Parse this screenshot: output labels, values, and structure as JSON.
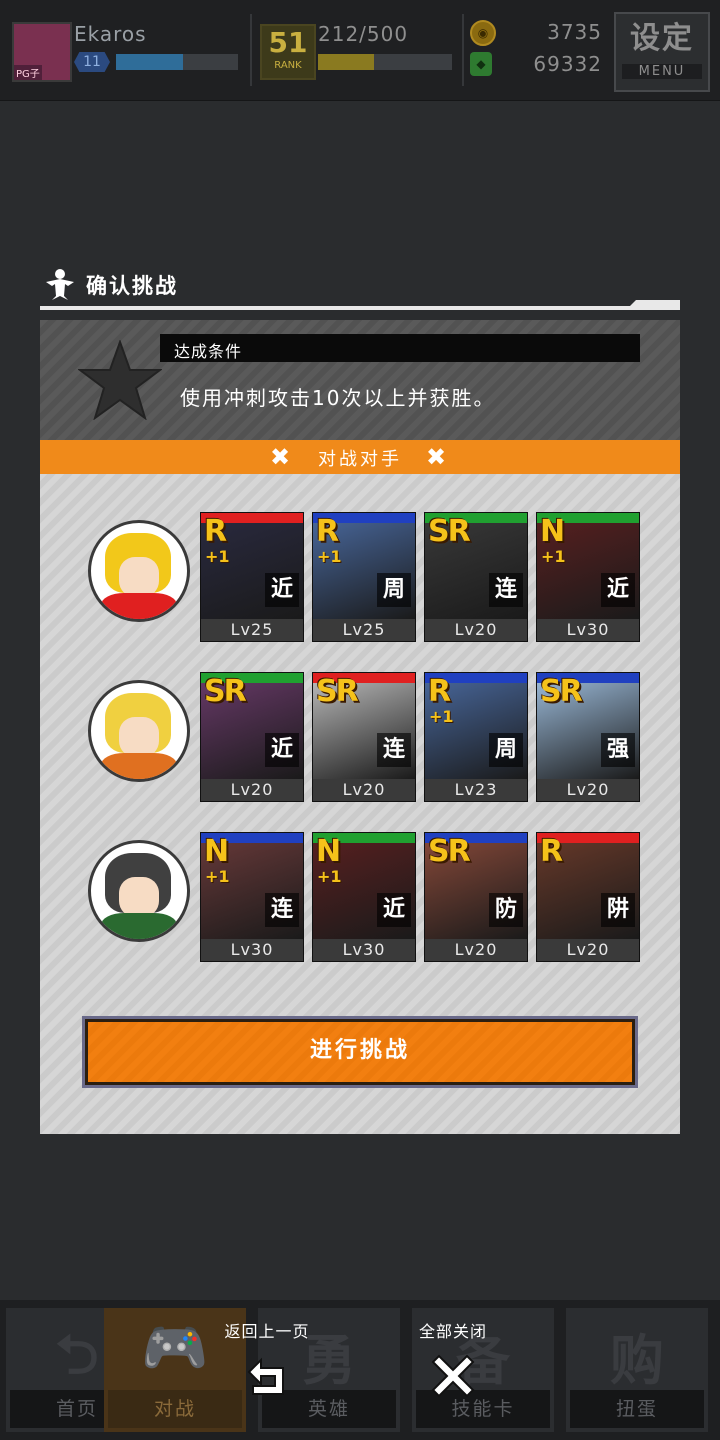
{
  "topbar": {
    "avatar_tag": "PG子",
    "player_name": "Ekaros",
    "level": "11",
    "xp_fraction": 0.55,
    "rank_number": "51",
    "rank_label": "RANK",
    "stamina": "212/500",
    "stamina_fraction": 0.42,
    "coins_icon": "coin-icon",
    "coins": "3735",
    "gems_icon": "gem-icon",
    "gems": "69332",
    "menu_title": "设定",
    "menu_sub": "MENU"
  },
  "modal": {
    "title": "确认挑战",
    "condition_label": "达成条件",
    "condition_text": "使用冲刺攻击10次以上并获胜。",
    "opponents_title": "对战对手",
    "opponents": [
      {
        "hair": "#f2c81a",
        "body": "#e02020",
        "cards": [
          {
            "rarity": "R",
            "plus": "+1",
            "type": "近",
            "level": "Lv25",
            "top": "#e02020",
            "art": "#2a2a40"
          },
          {
            "rarity": "R",
            "plus": "+1",
            "type": "周",
            "level": "Lv25",
            "top": "#2040c0",
            "art": "#4a6aa0"
          },
          {
            "rarity": "SR",
            "plus": "",
            "type": "连",
            "level": "Lv20",
            "top": "#20a030",
            "art": "#3a3a3a"
          },
          {
            "rarity": "N",
            "plus": "+1",
            "type": "近",
            "level": "Lv30",
            "top": "#20a030",
            "art": "#5a2020"
          }
        ]
      },
      {
        "hair": "#f0d040",
        "body": "#e07020",
        "cards": [
          {
            "rarity": "SR",
            "plus": "",
            "type": "近",
            "level": "Lv20",
            "top": "#20a030",
            "art": "#6a3a6a"
          },
          {
            "rarity": "SR",
            "plus": "",
            "type": "连",
            "level": "Lv20",
            "top": "#e02020",
            "art": "#c0c0c0"
          },
          {
            "rarity": "R",
            "plus": "+1",
            "type": "周",
            "level": "Lv23",
            "top": "#2040c0",
            "art": "#4a6aa0"
          },
          {
            "rarity": "SR",
            "plus": "",
            "type": "强",
            "level": "Lv20",
            "top": "#2040c0",
            "art": "#a0c0e0"
          }
        ]
      },
      {
        "hair": "#404040",
        "body": "#2a6a30",
        "cards": [
          {
            "rarity": "N",
            "plus": "+1",
            "type": "连",
            "level": "Lv30",
            "top": "#2040c0",
            "art": "#6a3a3a"
          },
          {
            "rarity": "N",
            "plus": "+1",
            "type": "近",
            "level": "Lv30",
            "top": "#20a030",
            "art": "#5a2020"
          },
          {
            "rarity": "SR",
            "plus": "",
            "type": "防",
            "level": "Lv20",
            "top": "#2040c0",
            "art": "#8a4a3a"
          },
          {
            "rarity": "R",
            "plus": "",
            "type": "阱",
            "level": "Lv20",
            "top": "#e02020",
            "art": "#6a3a2a"
          }
        ]
      }
    ],
    "challenge_button": "进行挑战"
  },
  "bottom_nav": [
    {
      "glyph": "⮌",
      "label": "首页"
    },
    {
      "glyph": "🎮",
      "label": "对战"
    },
    {
      "glyph": "勇",
      "label": "英雄"
    },
    {
      "glyph": "备",
      "label": "技能卡"
    },
    {
      "glyph": "购",
      "label": "扭蛋"
    }
  ],
  "overlay": {
    "back_label": "返回上一页",
    "close_all_label": "全部关闭"
  },
  "colors": {
    "accent_orange": "#f08a1a",
    "modal_bg": "#d6d6d6",
    "condition_bg": "#5a5a5a"
  }
}
